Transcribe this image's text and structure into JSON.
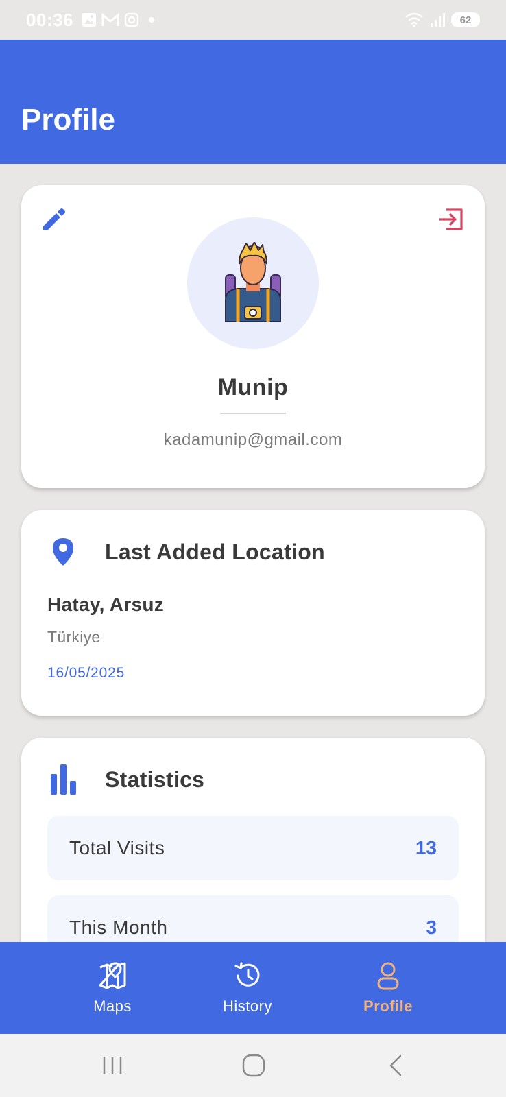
{
  "status_bar": {
    "time": "00:36",
    "battery": "62",
    "icons": [
      "gallery-icon",
      "gmail-icon",
      "instagram-icon",
      "dot-icon",
      "wifi-icon",
      "signal-icon",
      "battery-icon"
    ]
  },
  "header": {
    "title": "Profile"
  },
  "profile": {
    "name": "Munip",
    "email": "kadamunip@gmail.com",
    "edit_icon": "pencil-icon",
    "logout_icon": "logout-icon"
  },
  "last_location": {
    "title": "Last Added Location",
    "city": "Hatay, Arsuz",
    "country": "Türkiye",
    "date": "16/05/2025"
  },
  "statistics": {
    "title": "Statistics",
    "rows": [
      {
        "label": "Total Visits",
        "value": "13"
      },
      {
        "label": "This Month",
        "value": "3"
      }
    ]
  },
  "bottom_nav": {
    "items": [
      {
        "label": "Maps",
        "icon": "map-icon",
        "active": false
      },
      {
        "label": "History",
        "icon": "history-icon",
        "active": false
      },
      {
        "label": "Profile",
        "icon": "person-icon",
        "active": true
      }
    ]
  },
  "colors": {
    "primary": "#4169e1",
    "accent_active": "#f0b27a",
    "logout": "#d84361"
  }
}
